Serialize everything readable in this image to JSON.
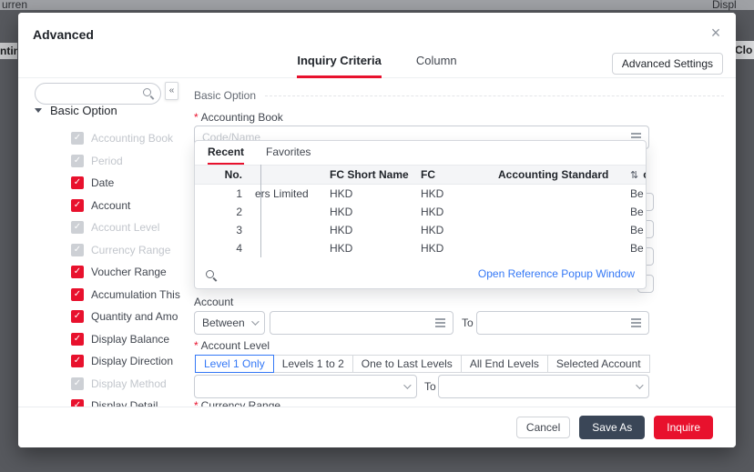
{
  "backdrop": {
    "top_left": "urren",
    "top_right": "Displ",
    "left_edge": "ntin",
    "right_edge": "Clo"
  },
  "dialog": {
    "title": "Advanced",
    "close_icon": "×",
    "tab_inquiry": "Inquiry Criteria",
    "tab_column": "Column",
    "advanced_settings": "Advanced Settings"
  },
  "sidebar": {
    "collapse_icon": "«",
    "root_label": "Basic Option",
    "items": [
      {
        "label": "Accounting Book",
        "state": "disabled-checked"
      },
      {
        "label": "Period",
        "state": "disabled-checked"
      },
      {
        "label": "Date",
        "state": "checked"
      },
      {
        "label": "Account",
        "state": "checked"
      },
      {
        "label": "Account Level",
        "state": "disabled-checked"
      },
      {
        "label": "Currency Range",
        "state": "disabled-checked"
      },
      {
        "label": "Voucher Range",
        "state": "checked"
      },
      {
        "label": "Accumulation This",
        "state": "checked"
      },
      {
        "label": "Quantity and Amo",
        "state": "checked"
      },
      {
        "label": "Display Balance",
        "state": "checked"
      },
      {
        "label": "Display Direction",
        "state": "checked"
      },
      {
        "label": "Display Method",
        "state": "disabled-checked"
      },
      {
        "label": "Display Detail",
        "state": "checked"
      }
    ]
  },
  "main": {
    "asterisk": "*",
    "section_title": "Basic Option",
    "accounting_book": {
      "label": "Accounting Book",
      "placeholder": "Code/Name"
    },
    "popup": {
      "tab_recent": "Recent",
      "tab_favorites": "Favorites",
      "headers": {
        "no": "No.",
        "name": "",
        "fc_short": "FC Short Name",
        "fc": "FC",
        "standard": "Accounting Standard",
        "clipped": "c"
      },
      "rows": [
        {
          "no": "1",
          "name": "ers Limited",
          "fc_short": "HKD",
          "fc": "HKD",
          "standard": "",
          "clipped": "Be"
        },
        {
          "no": "2",
          "name": "",
          "fc_short": "HKD",
          "fc": "HKD",
          "standard": "",
          "clipped": "Be"
        },
        {
          "no": "3",
          "name": "",
          "fc_short": "HKD",
          "fc": "HKD",
          "standard": "",
          "clipped": "Be"
        },
        {
          "no": "4",
          "name": "",
          "fc_short": "HKD",
          "fc": "HKD",
          "standard": "",
          "clipped": "Be"
        }
      ],
      "link": "Open Reference Popup Window"
    },
    "account": {
      "label": "Account",
      "operator": "Between",
      "to": "To"
    },
    "account_level": {
      "label": "Account Level",
      "segments": [
        "Level 1 Only",
        "Levels 1 to 2",
        "One to Last Levels",
        "All End Levels",
        "Selected Account"
      ],
      "active_segment": "Level 1 Only",
      "to": "To"
    },
    "clipped_label": "Currency Range"
  },
  "footer": {
    "cancel": "Cancel",
    "save_as": "Save As",
    "inquire": "Inquire"
  },
  "colors": {
    "accent": "#e8112d",
    "blue": "#3478f6",
    "dark_button": "#3a4657"
  }
}
